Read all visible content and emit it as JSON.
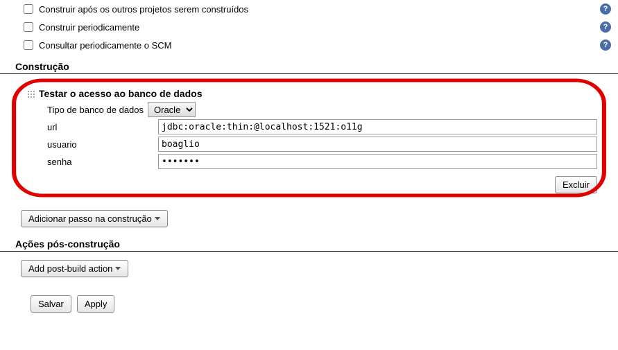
{
  "triggers": {
    "build_after": "Construir após os outros projetos serem construídos",
    "build_periodic": "Construir periodicamente",
    "poll_scm": "Consultar periodicamente o SCM"
  },
  "sections": {
    "build": "Construção",
    "post_build": "Ações pós-construção"
  },
  "db_step": {
    "title": "Testar o acesso ao banco de dados",
    "db_type_label": "Tipo de banco de dados",
    "db_type_value": "Oracle",
    "url_label": "url",
    "url_value": "jdbc:oracle:thin:@localhost:1521:o11g",
    "user_label": "usuario",
    "user_value": "boaglio",
    "password_label": "senha",
    "password_value": "•••••••",
    "delete_label": "Excluir"
  },
  "buttons": {
    "add_build_step": "Adicionar passo na construção",
    "add_post_build": "Add post-build action",
    "save": "Salvar",
    "apply": "Apply"
  }
}
